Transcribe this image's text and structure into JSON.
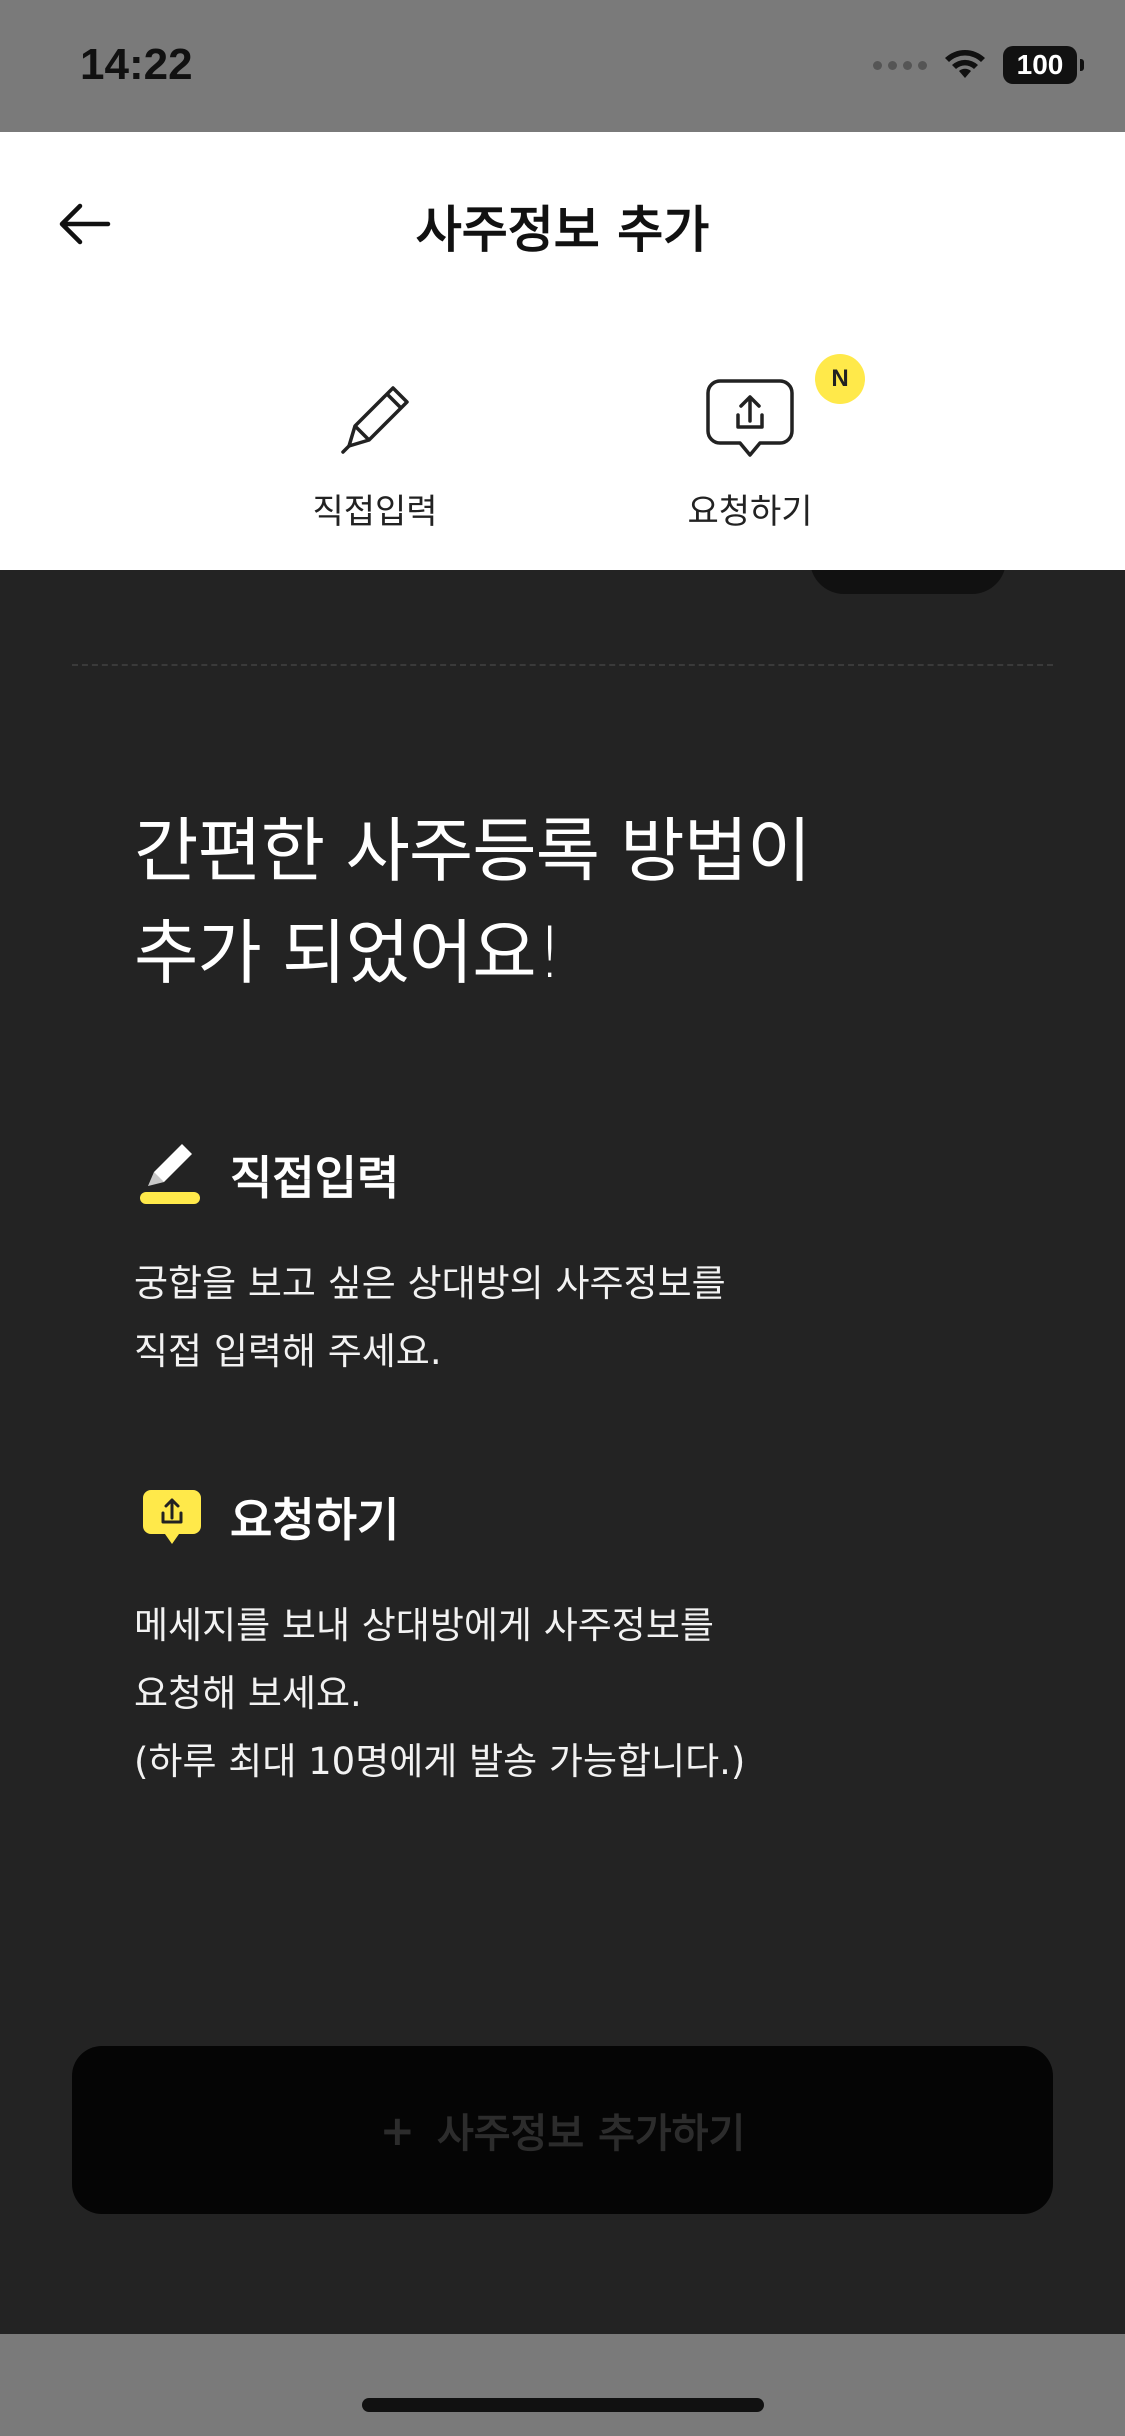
{
  "status_bar": {
    "time": "14:22",
    "battery": "100"
  },
  "header": {
    "title": "사주정보 추가"
  },
  "options": {
    "direct": {
      "label": "직접입력"
    },
    "request": {
      "label": "요청하기",
      "badge": "N"
    }
  },
  "guide": {
    "headline_line1": "간편한 사주등록 방법이",
    "headline_line2": "추가 되었어요!",
    "direct": {
      "title": "직접입력",
      "desc_line1": "궁합을 보고 싶은 상대방의 사주정보를",
      "desc_line2": "직접 입력해 주세요."
    },
    "request": {
      "title": "요청하기",
      "desc_line1": "메세지를 보내 상대방에게 사주정보를",
      "desc_line2": "요청해 보세요.",
      "desc_line3": "(하루 최대 10명에게 발송 가능합니다.)"
    }
  },
  "cta": {
    "plus": "+",
    "label": "사주정보 추가하기"
  },
  "colors": {
    "accent": "#ffe94a",
    "dim": "#232323",
    "sheet": "#ffffff"
  },
  "icons": [
    "back-arrow-icon",
    "pencil-icon",
    "share-bubble-icon",
    "wifi-icon",
    "battery-icon"
  ]
}
